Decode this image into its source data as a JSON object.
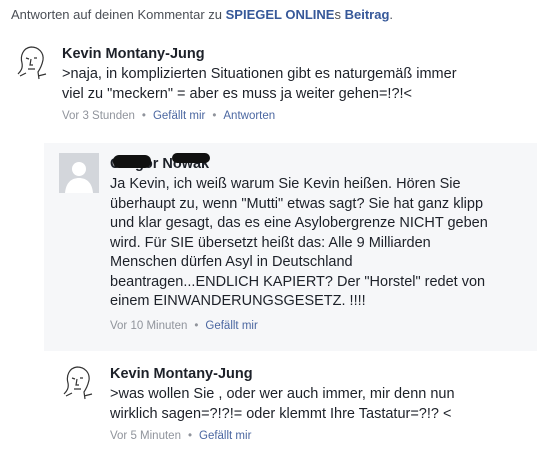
{
  "header": {
    "prefix": "Antworten auf deinen Kommentar zu ",
    "site_link": "SPIEGEL ONLINE",
    "possessive": "s ",
    "post_link": "Beitrag",
    "suffix": "."
  },
  "comments": [
    {
      "author": "Kevin Montany-Jung",
      "text_lines": [
        ">naja, in komplizierten Situationen gibt es naturgemäß immer",
        "viel  zu \"meckern\"  = aber es muss ja weiter gehen=!?!<"
      ],
      "time": "Vor 3 Stunden",
      "like_label": "Gefällt mir",
      "reply_label": "Antworten"
    },
    {
      "author": "Gregor Nowak",
      "text_lines": [
        "Ja Kevin, ich weiß warum Sie Kevin heißen.  Hören Sie",
        "überhaupt zu, wenn \"Mutti\" etwas sagt? Sie hat ganz klipp",
        "und klar gesagt, das es eine Asylobergrenze NICHT geben",
        "wird. Für SIE übersetzt heißt das: Alle 9 Milliarden",
        "Menschen dürfen Asyl in Deutschland",
        "beantragen...ENDLICH KAPIERT? Der \"Horstel\" redet von",
        "einem EINWANDERUNGSGESETZ. !!!!"
      ],
      "time": "Vor 10 Minuten",
      "like_label": "Gefällt mir"
    },
    {
      "author": "Kevin Montany-Jung",
      "text_lines": [
        ">was wollen Sie , oder wer auch immer,  mir denn nun",
        "wirklich sagen=?!?!= oder klemmt Ihre Tastatur=?!? <"
      ],
      "time": "Vor 5 Minuten",
      "like_label": "Gefällt mir"
    }
  ],
  "colors": {
    "link": "#365899",
    "meta": "#90949c",
    "reply_background": "#f6f7f9"
  }
}
